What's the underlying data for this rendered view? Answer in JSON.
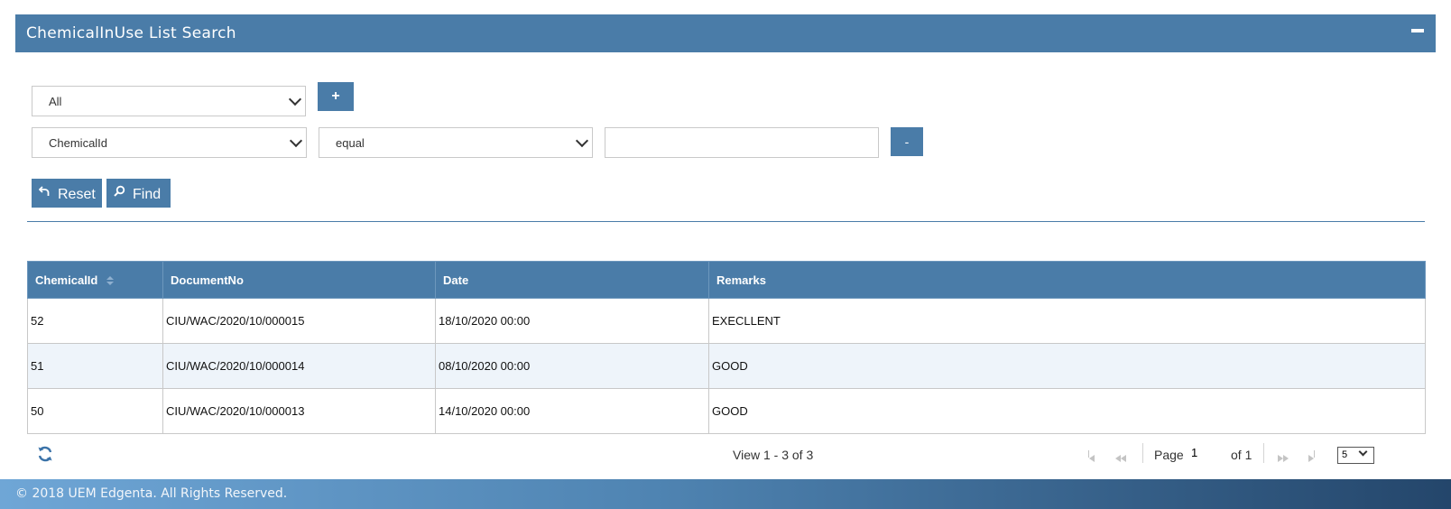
{
  "header": {
    "title": "ChemicalInUse List Search"
  },
  "filters": {
    "group_select": {
      "value": "All"
    },
    "add_button_label": "+",
    "field_select": {
      "value": "ChemicalId"
    },
    "operator_select": {
      "value": "equal"
    },
    "value_input": {
      "value": ""
    },
    "remove_button_label": "-",
    "reset_label": "Reset",
    "find_label": "Find"
  },
  "table": {
    "columns": [
      "ChemicalId",
      "DocumentNo",
      "Date",
      "Remarks"
    ],
    "rows": [
      [
        "52",
        "CIU/WAC/2020/10/000015",
        "18/10/2020 00:00",
        "EXECLLENT"
      ],
      [
        "51",
        "CIU/WAC/2020/10/000014",
        "08/10/2020 00:00",
        "GOOD"
      ],
      [
        "50",
        "CIU/WAC/2020/10/000013",
        "14/10/2020 00:00",
        "GOOD"
      ]
    ]
  },
  "pager": {
    "view_text": "View 1 - 3 of 3",
    "page_label": "Page",
    "page_value": "1",
    "of_text": "of 1",
    "rows_per_page": "5"
  },
  "footer": {
    "copyright": "© 2018 UEM Edgenta. All Rights Reserved."
  },
  "colors": {
    "accent": "#4a7ca8"
  }
}
